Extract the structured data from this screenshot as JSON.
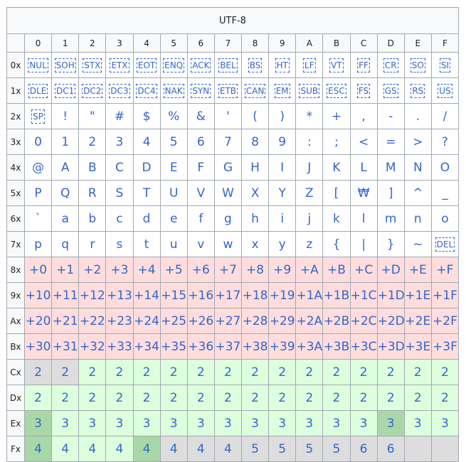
{
  "table": {
    "caption": "UTF-8",
    "columns": [
      "0",
      "1",
      "2",
      "3",
      "4",
      "5",
      "6",
      "7",
      "8",
      "9",
      "A",
      "B",
      "C",
      "D",
      "E",
      "F"
    ],
    "rows": [
      {
        "head": "0x",
        "cells": [
          {
            "t": "NUL",
            "k": "ctl"
          },
          {
            "t": "SOH",
            "k": "ctl"
          },
          {
            "t": "STX",
            "k": "ctl"
          },
          {
            "t": "ETX",
            "k": "ctl"
          },
          {
            "t": "EOT",
            "k": "ctl"
          },
          {
            "t": "ENQ",
            "k": "ctl"
          },
          {
            "t": "ACK",
            "k": "ctl"
          },
          {
            "t": "BEL",
            "k": "ctl"
          },
          {
            "t": "BS",
            "k": "ctl"
          },
          {
            "t": "HT",
            "k": "ctl"
          },
          {
            "t": "LF",
            "k": "ctl"
          },
          {
            "t": "VT",
            "k": "ctl"
          },
          {
            "t": "FF",
            "k": "ctl"
          },
          {
            "t": "CR",
            "k": "ctl"
          },
          {
            "t": "SO",
            "k": "ctl"
          },
          {
            "t": "SI",
            "k": "ctl"
          }
        ]
      },
      {
        "head": "1x",
        "cells": [
          {
            "t": "DLE",
            "k": "ctl"
          },
          {
            "t": "DC1",
            "k": "ctl"
          },
          {
            "t": "DC2",
            "k": "ctl"
          },
          {
            "t": "DC3",
            "k": "ctl"
          },
          {
            "t": "DC4",
            "k": "ctl"
          },
          {
            "t": "NAK",
            "k": "ctl"
          },
          {
            "t": "SYN",
            "k": "ctl"
          },
          {
            "t": "ETB",
            "k": "ctl"
          },
          {
            "t": "CAN",
            "k": "ctl"
          },
          {
            "t": "EM",
            "k": "ctl"
          },
          {
            "t": "SUB",
            "k": "ctl"
          },
          {
            "t": "ESC",
            "k": "ctl"
          },
          {
            "t": "FS",
            "k": "ctl"
          },
          {
            "t": "GS",
            "k": "ctl"
          },
          {
            "t": "RS",
            "k": "ctl"
          },
          {
            "t": "US",
            "k": "ctl"
          }
        ]
      },
      {
        "head": "2x",
        "cells": [
          {
            "t": "SP",
            "k": "ctl"
          },
          {
            "t": "!",
            "k": "chr"
          },
          {
            "t": "\"",
            "k": "chr"
          },
          {
            "t": "#",
            "k": "chr"
          },
          {
            "t": "$",
            "k": "chr"
          },
          {
            "t": "%",
            "k": "chr"
          },
          {
            "t": "&",
            "k": "chr"
          },
          {
            "t": "'",
            "k": "chr"
          },
          {
            "t": "(",
            "k": "chr"
          },
          {
            "t": ")",
            "k": "chr"
          },
          {
            "t": "*",
            "k": "chr"
          },
          {
            "t": "+",
            "k": "chr"
          },
          {
            "t": ",",
            "k": "chr"
          },
          {
            "t": "-",
            "k": "chr"
          },
          {
            "t": ".",
            "k": "chr"
          },
          {
            "t": "/",
            "k": "chr"
          }
        ]
      },
      {
        "head": "3x",
        "cells": [
          {
            "t": "0",
            "k": "chr"
          },
          {
            "t": "1",
            "k": "chr"
          },
          {
            "t": "2",
            "k": "chr"
          },
          {
            "t": "3",
            "k": "chr"
          },
          {
            "t": "4",
            "k": "chr"
          },
          {
            "t": "5",
            "k": "chr"
          },
          {
            "t": "6",
            "k": "chr"
          },
          {
            "t": "7",
            "k": "chr"
          },
          {
            "t": "8",
            "k": "chr"
          },
          {
            "t": "9",
            "k": "chr"
          },
          {
            "t": ":",
            "k": "chr"
          },
          {
            "t": ";",
            "k": "chr"
          },
          {
            "t": "<",
            "k": "chr"
          },
          {
            "t": "=",
            "k": "chr"
          },
          {
            "t": ">",
            "k": "chr"
          },
          {
            "t": "?",
            "k": "chr"
          }
        ]
      },
      {
        "head": "4x",
        "cells": [
          {
            "t": "@",
            "k": "chr"
          },
          {
            "t": "A",
            "k": "chr"
          },
          {
            "t": "B",
            "k": "chr"
          },
          {
            "t": "C",
            "k": "chr"
          },
          {
            "t": "D",
            "k": "chr"
          },
          {
            "t": "E",
            "k": "chr"
          },
          {
            "t": "F",
            "k": "chr"
          },
          {
            "t": "G",
            "k": "chr"
          },
          {
            "t": "H",
            "k": "chr"
          },
          {
            "t": "I",
            "k": "chr"
          },
          {
            "t": "J",
            "k": "chr"
          },
          {
            "t": "K",
            "k": "chr"
          },
          {
            "t": "L",
            "k": "chr"
          },
          {
            "t": "M",
            "k": "chr"
          },
          {
            "t": "N",
            "k": "chr"
          },
          {
            "t": "O",
            "k": "chr"
          }
        ]
      },
      {
        "head": "5x",
        "cells": [
          {
            "t": "P",
            "k": "chr"
          },
          {
            "t": "Q",
            "k": "chr"
          },
          {
            "t": "R",
            "k": "chr"
          },
          {
            "t": "S",
            "k": "chr"
          },
          {
            "t": "T",
            "k": "chr"
          },
          {
            "t": "U",
            "k": "chr"
          },
          {
            "t": "V",
            "k": "chr"
          },
          {
            "t": "W",
            "k": "chr"
          },
          {
            "t": "X",
            "k": "chr"
          },
          {
            "t": "Y",
            "k": "chr"
          },
          {
            "t": "Z",
            "k": "chr"
          },
          {
            "t": "[",
            "k": "chr"
          },
          {
            "t": "₩",
            "k": "chr"
          },
          {
            "t": "]",
            "k": "chr"
          },
          {
            "t": "^",
            "k": "chr"
          },
          {
            "t": "_",
            "k": "chr"
          }
        ]
      },
      {
        "head": "6x",
        "cells": [
          {
            "t": "`",
            "k": "chr"
          },
          {
            "t": "a",
            "k": "chr"
          },
          {
            "t": "b",
            "k": "chr"
          },
          {
            "t": "c",
            "k": "chr"
          },
          {
            "t": "d",
            "k": "chr"
          },
          {
            "t": "e",
            "k": "chr"
          },
          {
            "t": "f",
            "k": "chr"
          },
          {
            "t": "g",
            "k": "chr"
          },
          {
            "t": "h",
            "k": "chr"
          },
          {
            "t": "i",
            "k": "chr"
          },
          {
            "t": "j",
            "k": "chr"
          },
          {
            "t": "k",
            "k": "chr"
          },
          {
            "t": "l",
            "k": "chr"
          },
          {
            "t": "m",
            "k": "chr"
          },
          {
            "t": "n",
            "k": "chr"
          },
          {
            "t": "o",
            "k": "chr"
          }
        ]
      },
      {
        "head": "7x",
        "cells": [
          {
            "t": "p",
            "k": "chr"
          },
          {
            "t": "q",
            "k": "chr"
          },
          {
            "t": "r",
            "k": "chr"
          },
          {
            "t": "s",
            "k": "chr"
          },
          {
            "t": "t",
            "k": "chr"
          },
          {
            "t": "u",
            "k": "chr"
          },
          {
            "t": "v",
            "k": "chr"
          },
          {
            "t": "w",
            "k": "chr"
          },
          {
            "t": "x",
            "k": "chr"
          },
          {
            "t": "y",
            "k": "chr"
          },
          {
            "t": "z",
            "k": "chr"
          },
          {
            "t": "{",
            "k": "chr"
          },
          {
            "t": "|",
            "k": "chr"
          },
          {
            "t": "}",
            "k": "chr"
          },
          {
            "t": "~",
            "k": "chr"
          },
          {
            "t": "DEL",
            "k": "ctl"
          }
        ]
      },
      {
        "head": "8x",
        "cells": [
          {
            "t": "+0",
            "k": "cont"
          },
          {
            "t": "+1",
            "k": "cont"
          },
          {
            "t": "+2",
            "k": "cont"
          },
          {
            "t": "+3",
            "k": "cont"
          },
          {
            "t": "+4",
            "k": "cont"
          },
          {
            "t": "+5",
            "k": "cont"
          },
          {
            "t": "+6",
            "k": "cont"
          },
          {
            "t": "+7",
            "k": "cont"
          },
          {
            "t": "+8",
            "k": "cont"
          },
          {
            "t": "+9",
            "k": "cont"
          },
          {
            "t": "+A",
            "k": "cont"
          },
          {
            "t": "+B",
            "k": "cont"
          },
          {
            "t": "+C",
            "k": "cont"
          },
          {
            "t": "+D",
            "k": "cont"
          },
          {
            "t": "+E",
            "k": "cont"
          },
          {
            "t": "+F",
            "k": "cont"
          }
        ]
      },
      {
        "head": "9x",
        "cells": [
          {
            "t": "+10",
            "k": "cont"
          },
          {
            "t": "+11",
            "k": "cont"
          },
          {
            "t": "+12",
            "k": "cont"
          },
          {
            "t": "+13",
            "k": "cont"
          },
          {
            "t": "+14",
            "k": "cont"
          },
          {
            "t": "+15",
            "k": "cont"
          },
          {
            "t": "+16",
            "k": "cont"
          },
          {
            "t": "+17",
            "k": "cont"
          },
          {
            "t": "+18",
            "k": "cont"
          },
          {
            "t": "+19",
            "k": "cont"
          },
          {
            "t": "+1A",
            "k": "cont"
          },
          {
            "t": "+1B",
            "k": "cont"
          },
          {
            "t": "+1C",
            "k": "cont"
          },
          {
            "t": "+1D",
            "k": "cont"
          },
          {
            "t": "+1E",
            "k": "cont"
          },
          {
            "t": "+1F",
            "k": "cont"
          }
        ]
      },
      {
        "head": "Ax",
        "cells": [
          {
            "t": "+20",
            "k": "cont"
          },
          {
            "t": "+21",
            "k": "cont"
          },
          {
            "t": "+22",
            "k": "cont"
          },
          {
            "t": "+23",
            "k": "cont"
          },
          {
            "t": "+24",
            "k": "cont"
          },
          {
            "t": "+25",
            "k": "cont"
          },
          {
            "t": "+26",
            "k": "cont"
          },
          {
            "t": "+27",
            "k": "cont"
          },
          {
            "t": "+28",
            "k": "cont"
          },
          {
            "t": "+29",
            "k": "cont"
          },
          {
            "t": "+2A",
            "k": "cont"
          },
          {
            "t": "+2B",
            "k": "cont"
          },
          {
            "t": "+2C",
            "k": "cont"
          },
          {
            "t": "+2D",
            "k": "cont"
          },
          {
            "t": "+2E",
            "k": "cont"
          },
          {
            "t": "+2F",
            "k": "cont"
          }
        ]
      },
      {
        "head": "Bx",
        "cells": [
          {
            "t": "+30",
            "k": "cont"
          },
          {
            "t": "+31",
            "k": "cont"
          },
          {
            "t": "+32",
            "k": "cont"
          },
          {
            "t": "+33",
            "k": "cont"
          },
          {
            "t": "+34",
            "k": "cont"
          },
          {
            "t": "+35",
            "k": "cont"
          },
          {
            "t": "+36",
            "k": "cont"
          },
          {
            "t": "+37",
            "k": "cont"
          },
          {
            "t": "+38",
            "k": "cont"
          },
          {
            "t": "+39",
            "k": "cont"
          },
          {
            "t": "+3A",
            "k": "cont"
          },
          {
            "t": "+3B",
            "k": "cont"
          },
          {
            "t": "+3C",
            "k": "cont"
          },
          {
            "t": "+3D",
            "k": "cont"
          },
          {
            "t": "+3E",
            "k": "cont"
          },
          {
            "t": "+3F",
            "k": "cont"
          }
        ]
      },
      {
        "head": "Cx",
        "cells": [
          {
            "t": "2",
            "k": "inv"
          },
          {
            "t": "2",
            "k": "inv"
          },
          {
            "t": "2",
            "k": "lead"
          },
          {
            "t": "2",
            "k": "lead"
          },
          {
            "t": "2",
            "k": "lead"
          },
          {
            "t": "2",
            "k": "lead"
          },
          {
            "t": "2",
            "k": "lead"
          },
          {
            "t": "2",
            "k": "lead"
          },
          {
            "t": "2",
            "k": "lead"
          },
          {
            "t": "2",
            "k": "lead"
          },
          {
            "t": "2",
            "k": "lead"
          },
          {
            "t": "2",
            "k": "lead"
          },
          {
            "t": "2",
            "k": "lead"
          },
          {
            "t": "2",
            "k": "lead"
          },
          {
            "t": "2",
            "k": "lead"
          },
          {
            "t": "2",
            "k": "lead"
          }
        ]
      },
      {
        "head": "Dx",
        "cells": [
          {
            "t": "2",
            "k": "lead"
          },
          {
            "t": "2",
            "k": "lead"
          },
          {
            "t": "2",
            "k": "lead"
          },
          {
            "t": "2",
            "k": "lead"
          },
          {
            "t": "2",
            "k": "lead"
          },
          {
            "t": "2",
            "k": "lead"
          },
          {
            "t": "2",
            "k": "lead"
          },
          {
            "t": "2",
            "k": "lead"
          },
          {
            "t": "2",
            "k": "lead"
          },
          {
            "t": "2",
            "k": "lead"
          },
          {
            "t": "2",
            "k": "lead"
          },
          {
            "t": "2",
            "k": "lead"
          },
          {
            "t": "2",
            "k": "lead"
          },
          {
            "t": "2",
            "k": "lead"
          },
          {
            "t": "2",
            "k": "lead"
          },
          {
            "t": "2",
            "k": "lead"
          }
        ]
      },
      {
        "head": "Ex",
        "cells": [
          {
            "t": "3",
            "k": "restr-blk"
          },
          {
            "t": "3",
            "k": "lead-blk"
          },
          {
            "t": "3",
            "k": "lead-blk"
          },
          {
            "t": "3",
            "k": "lead-blk"
          },
          {
            "t": "3",
            "k": "lead"
          },
          {
            "t": "3",
            "k": "lead"
          },
          {
            "t": "3",
            "k": "lead"
          },
          {
            "t": "3",
            "k": "lead"
          },
          {
            "t": "3",
            "k": "lead"
          },
          {
            "t": "3",
            "k": "lead"
          },
          {
            "t": "3",
            "k": "lead-blk"
          },
          {
            "t": "3",
            "k": "lead"
          },
          {
            "t": "3",
            "k": "lead"
          },
          {
            "t": "3",
            "k": "restr"
          },
          {
            "t": "3",
            "k": "lead"
          },
          {
            "t": "3",
            "k": "lead"
          }
        ]
      },
      {
        "head": "Fx",
        "cells": [
          {
            "t": "4",
            "k": "restr"
          },
          {
            "t": "4",
            "k": "lead-blk"
          },
          {
            "t": "4",
            "k": "lead-blk"
          },
          {
            "t": "4",
            "k": "lead"
          },
          {
            "t": "4",
            "k": "restr"
          },
          {
            "t": "4",
            "k": "inv"
          },
          {
            "t": "4",
            "k": "inv"
          },
          {
            "t": "4",
            "k": "inv"
          },
          {
            "t": "5",
            "k": "inv"
          },
          {
            "t": "5",
            "k": "inv"
          },
          {
            "t": "5",
            "k": "inv"
          },
          {
            "t": "5",
            "k": "inv"
          },
          {
            "t": "6",
            "k": "inv"
          },
          {
            "t": "6",
            "k": "inv"
          },
          {
            "t": "",
            "k": "inv"
          },
          {
            "t": "",
            "k": "inv"
          }
        ]
      }
    ]
  },
  "colors": {
    "link_text": "#3366cc",
    "continuation_bg": "#ffdddd",
    "lead_bg": "#ddffdd",
    "invalid_bg": "#dddddd",
    "restricted_bg": "#a8d8a8",
    "header_bg": "#f8f9fa",
    "border": "#a2a9b1"
  }
}
